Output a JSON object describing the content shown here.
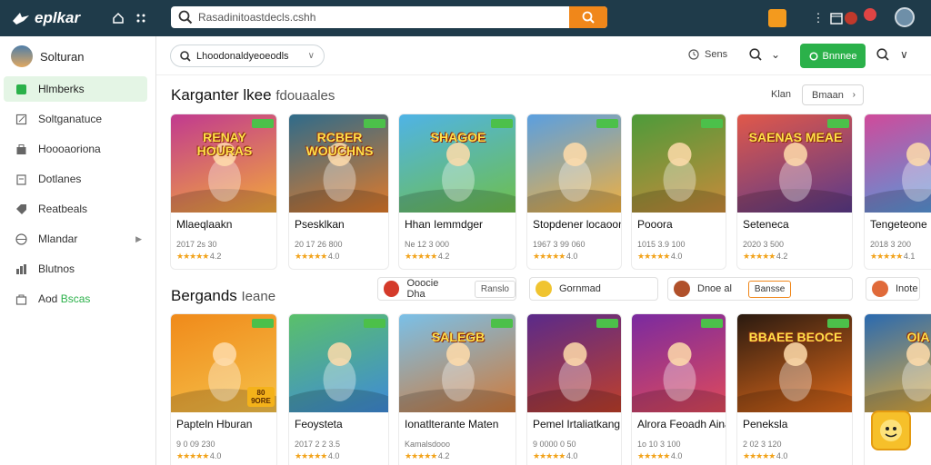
{
  "app": {
    "brand": "eplkar"
  },
  "topbar": {
    "search_text": "Rasadinitoastdecls.cshh"
  },
  "sidebar": {
    "header": "Solturan",
    "items": [
      {
        "label": "Hlmberks",
        "icon": "home-icon",
        "active": true
      },
      {
        "label": "Soltganatuce",
        "icon": "edit-icon"
      },
      {
        "label": "Hoooaoriona",
        "icon": "bag-icon"
      },
      {
        "label": "Dotlanes",
        "icon": "clipboard-icon"
      },
      {
        "label": "Reatbeals",
        "icon": "tag-icon"
      },
      {
        "label": "Mlandar",
        "icon": "globe-icon",
        "has_submenu": true
      },
      {
        "label": "Blutnos",
        "icon": "chart-icon"
      },
      {
        "label_prefix": "Aod",
        "label_green": "Bscas",
        "icon": "bag-outline-icon"
      }
    ]
  },
  "toolbar": {
    "filter_text": "Lhoodonaldyeoeodls",
    "sort_label": "Sens",
    "primary_label": "Bnnnee"
  },
  "section1": {
    "title": "Karganter lkee",
    "title_suffix": "fdouaales",
    "view_label": "Klan",
    "view_button": "Bmaan",
    "cards": [
      {
        "name": "Mlaeqlaakn",
        "meta": "2017 2s 30",
        "rating": "4.2",
        "thumb_text": "RENAY HOURAS",
        "colors": [
          "#c13a8f",
          "#f2a93b"
        ]
      },
      {
        "name": "Psesklkan",
        "meta": "20 17 26 800",
        "rating": "4.0",
        "thumb_text": "RCBER WOUCHNS",
        "colors": [
          "#2f6b8a",
          "#e07a2a"
        ]
      },
      {
        "name": "Hhan Iemmdger",
        "meta": "Ne 12 3 000",
        "rating": "4.2",
        "thumb_text": "SHAGOE",
        "colors": [
          "#4fb3e6",
          "#6fbf4a"
        ]
      },
      {
        "name": "Stopdener locaoon",
        "meta": "1967 3 99 060",
        "rating": "4.0",
        "thumb_text": "",
        "colors": [
          "#5a9fe0",
          "#f0b040"
        ]
      },
      {
        "name": "Pooora",
        "meta": "1015 3.9 100",
        "rating": "4.0",
        "thumb_text": "",
        "colors": [
          "#4d9b3a",
          "#c98a3a"
        ]
      },
      {
        "name": "Seteneca",
        "meta": "2020 3 500",
        "rating": "4.2",
        "thumb_text": "SAENAS MEAE",
        "colors": [
          "#e0584a",
          "#5a3a8a"
        ]
      },
      {
        "name": "Tengeteone",
        "meta": "2018 3 200",
        "rating": "4.1",
        "thumb_text": "",
        "colors": [
          "#d04a9a",
          "#4aa0e0"
        ]
      }
    ]
  },
  "section2": {
    "title": "Bergands",
    "title_suffix": "Ieane",
    "pills": [
      {
        "label": "Ooocie Dha",
        "subtag": "Ranslo",
        "color": "#d43a2a"
      },
      {
        "label": "Gornmad",
        "color": "#f0c430"
      },
      {
        "label": "Dnoe al",
        "subtag": "Bansse",
        "color": "#b0502a",
        "highlight": true
      },
      {
        "label": "Inote",
        "color": "#e06a3a"
      }
    ],
    "cards": [
      {
        "name": "Papteln Hburan",
        "meta": "9 0 09 230",
        "rating": "4.0",
        "thumb_text": "",
        "badge": "80 9ORE",
        "colors": [
          "#f08a1a",
          "#f5c14a"
        ]
      },
      {
        "name": "Feoysteta",
        "meta": "2017 2 2 3.5",
        "rating": "4.0",
        "thumb_text": "",
        "colors": [
          "#5ac06a",
          "#3f8ad8"
        ]
      },
      {
        "name": "Ionatlterante Maten",
        "meta": "Kamalsdooo",
        "rating": "4.2",
        "thumb_text": "SALEGB",
        "colors": [
          "#7ac0e8",
          "#d07a3a"
        ]
      },
      {
        "name": "Pemel Irtaliatkang",
        "meta": "9 0000 0 50",
        "rating": "4.0",
        "thumb_text": "",
        "colors": [
          "#5a2a8a",
          "#c0402a"
        ]
      },
      {
        "name": "Alrora Feoadh Aina",
        "meta": "1o 10 3 100",
        "rating": "4.0",
        "thumb_text": "",
        "colors": [
          "#7a2aa0",
          "#e04a5a"
        ]
      },
      {
        "name": "Peneksla",
        "meta": "2 02 3 120",
        "rating": "4.0",
        "thumb_text": "BBAEE BEOCE",
        "colors": [
          "#2a1a10",
          "#e06a1a"
        ]
      },
      {
        "name": "",
        "meta": "",
        "rating": "",
        "thumb_text": "OIA",
        "colors": [
          "#2a6ab0",
          "#f0b030"
        ]
      }
    ]
  }
}
